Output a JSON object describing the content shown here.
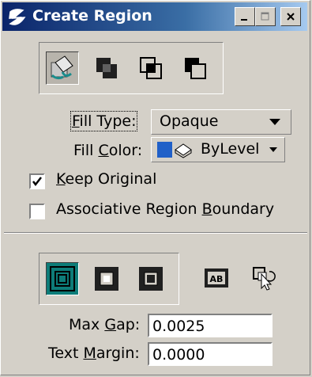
{
  "window": {
    "title": "Create Region"
  },
  "fill_type": {
    "label_pre": "",
    "label_ul": "F",
    "label_post": "ill Type:",
    "value": "Opaque"
  },
  "fill_color": {
    "label_pre": "Fill ",
    "label_ul": "C",
    "label_post": "olor:",
    "value": "ByLevel"
  },
  "keep_original": {
    "label_pre": "",
    "label_ul": "K",
    "label_post": "eep Original",
    "checked": true
  },
  "assoc_boundary": {
    "label_pre": "Associative Region ",
    "label_ul": "B",
    "label_post": "oundary",
    "checked": false
  },
  "max_gap": {
    "label_pre": "Max ",
    "label_ul": "G",
    "label_post": "ap:",
    "value": "0.0025"
  },
  "text_margin": {
    "label_pre": "Text ",
    "label_ul": "M",
    "label_post": "argin:",
    "value": "0.0000"
  },
  "colors": {
    "accent_teal": "#0d7c78",
    "fill_blue": "#2060c8"
  },
  "icons": {
    "method_tools": [
      "flood-region-icon",
      "union-icon",
      "intersection-icon",
      "difference-icon"
    ],
    "mode_tools": [
      "flood-text-mode-icon",
      "single-region-icon",
      "multi-region-icon",
      "text-ab-icon",
      "select-element-icon"
    ]
  }
}
